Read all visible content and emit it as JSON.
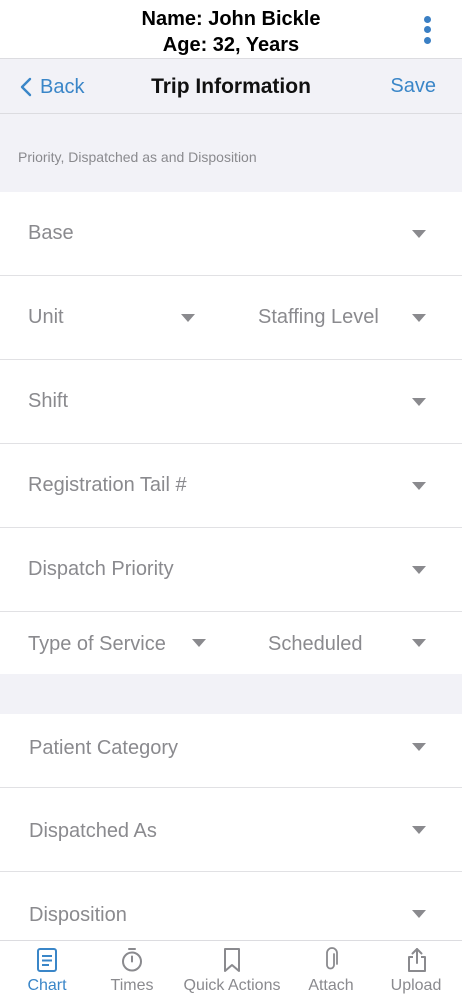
{
  "patient": {
    "name": "Name: John Bickle",
    "age": "Age: 32, Years"
  },
  "nav": {
    "back_label": "Back",
    "title": "Trip Information",
    "save_label": "Save"
  },
  "section": {
    "header": "Priority, Dispatched as and Disposition"
  },
  "fields": {
    "base": "Base",
    "unit": "Unit",
    "staffing_level": "Staffing Level",
    "shift": "Shift",
    "registration_tail": "Registration Tail #",
    "dispatch_priority": "Dispatch Priority",
    "type_of_service": "Type of Service",
    "scheduled": "Scheduled",
    "patient_category": "Patient Category",
    "dispatched_as": "Dispatched As",
    "disposition": "Disposition"
  },
  "tabs": [
    {
      "label": "Chart",
      "icon": "document-icon",
      "active": true
    },
    {
      "label": "Times",
      "icon": "stopwatch-icon",
      "active": false
    },
    {
      "label": "Quick Actions",
      "icon": "bookmark-icon",
      "active": false
    },
    {
      "label": "Attach",
      "icon": "paperclip-icon",
      "active": false
    },
    {
      "label": "Upload",
      "icon": "share-icon",
      "active": false
    }
  ],
  "colors": {
    "accent": "#3a86c8",
    "secondary_text": "#8a8a8e",
    "grouped_background": "#f2f2f7"
  }
}
